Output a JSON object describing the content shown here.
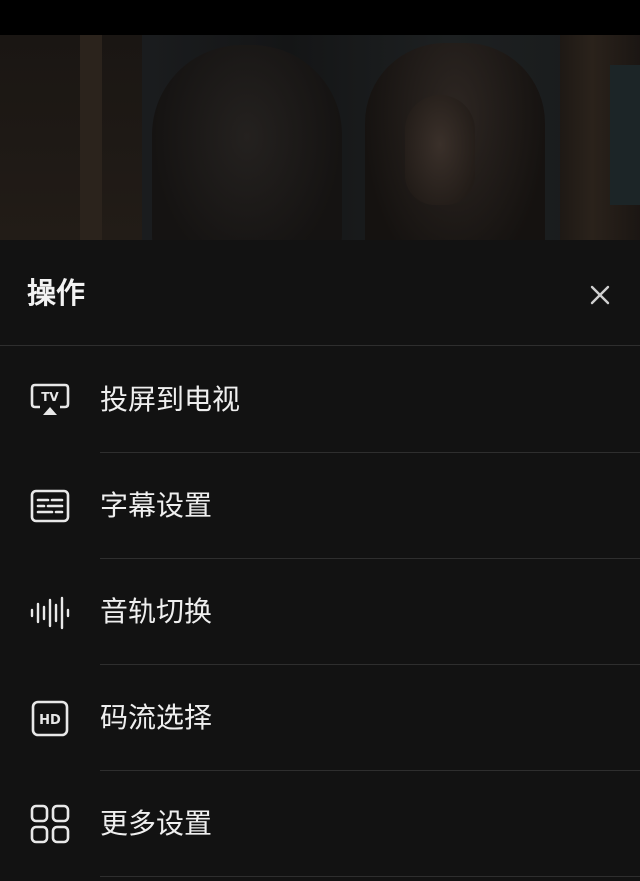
{
  "video_frame": {
    "icon": "video-frame"
  },
  "sheet": {
    "title": "操作",
    "close_icon": "close-icon"
  },
  "menu": {
    "items": [
      {
        "label": "投屏到电视",
        "icon": "tv-cast-icon"
      },
      {
        "label": "字幕设置",
        "icon": "subtitles-icon"
      },
      {
        "label": "音轨切换",
        "icon": "audio-track-icon"
      },
      {
        "label": "码流选择",
        "icon": "hd-icon"
      },
      {
        "label": "更多设置",
        "icon": "grid-icon"
      }
    ]
  },
  "colors": {
    "background": "#121212",
    "text": "#efefef",
    "divider": "#2e2e2e"
  }
}
